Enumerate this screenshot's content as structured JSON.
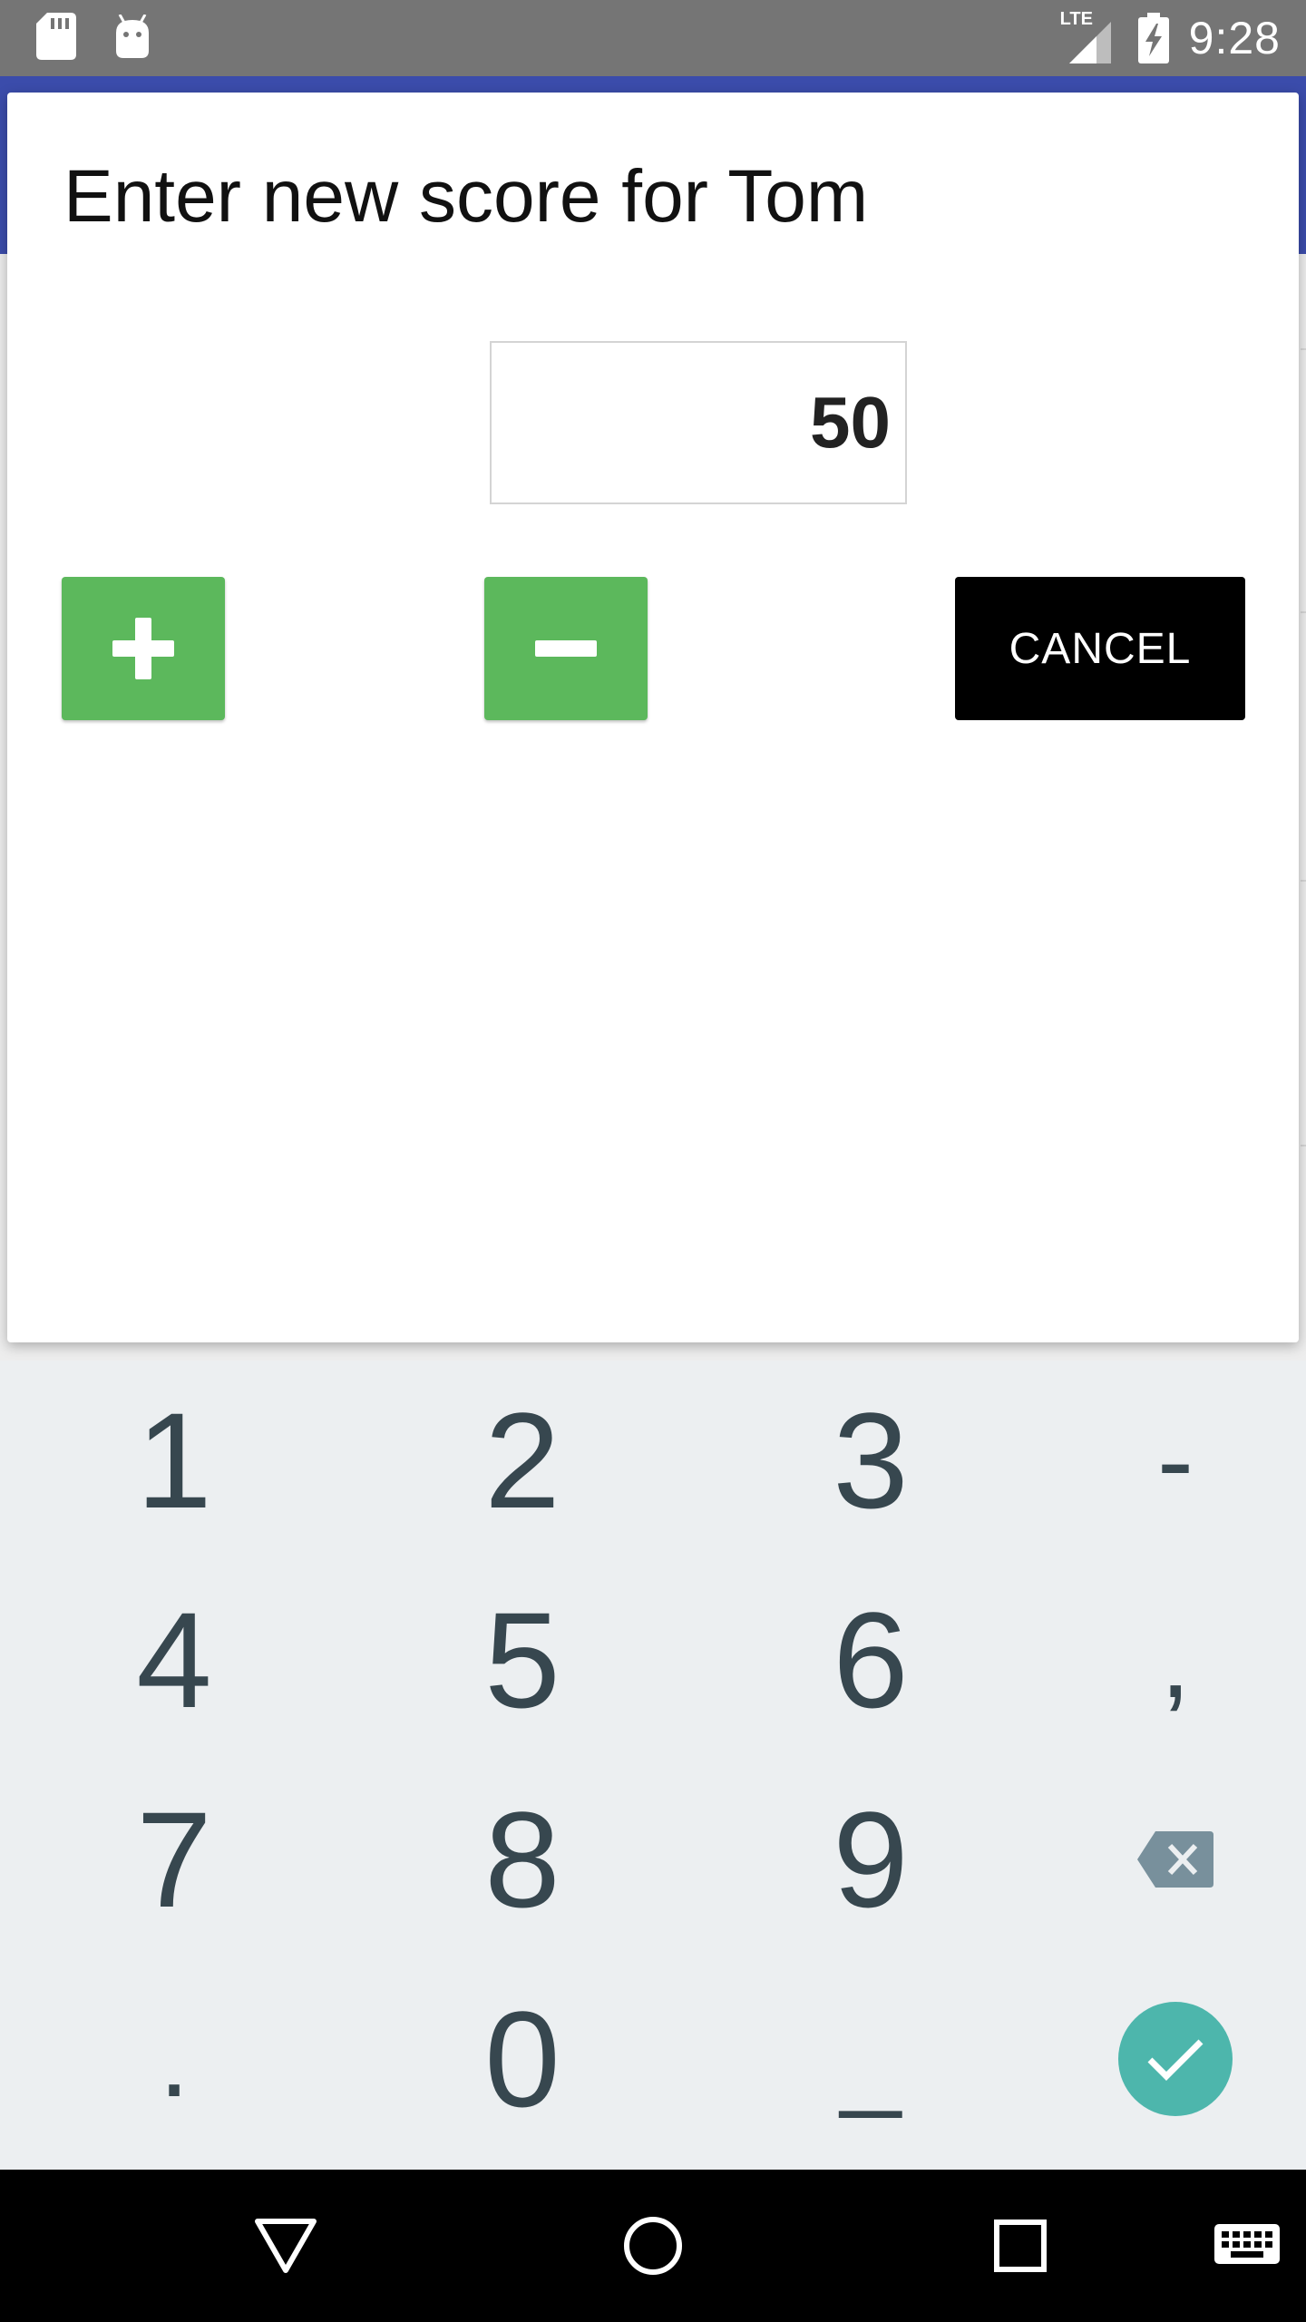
{
  "status_bar": {
    "time": "9:28",
    "network_label": "LTE",
    "icons": [
      "sd-card-icon",
      "android-debug-icon",
      "lte-signal-icon",
      "battery-charging-icon"
    ]
  },
  "dialog": {
    "title": "Enter new score for Tom",
    "score_value": "50",
    "increment_icon": "plus-icon",
    "decrement_icon": "minus-icon",
    "cancel_label": "CANCEL",
    "colors": {
      "action_green": "#5cb85c",
      "cancel_bg": "#000000",
      "toolbar": "#3f51b5"
    }
  },
  "keyboard": {
    "rows": [
      [
        "1",
        "2",
        "3",
        "-"
      ],
      [
        "4",
        "5",
        "6",
        ","
      ],
      [
        "7",
        "8",
        "9",
        "backspace-icon"
      ],
      [
        ".",
        "0",
        "_",
        "enter-check-icon"
      ]
    ],
    "labels": {
      "k1": "1",
      "k2": "2",
      "k3": "3",
      "kdash": "-",
      "k4": "4",
      "k5": "5",
      "k6": "6",
      "kcomma": ",",
      "k7": "7",
      "k8": "8",
      "k9": "9",
      "kdot": ".",
      "k0": "0",
      "kspace": "_"
    },
    "enter_color": "#4db6ac"
  },
  "nav_bar": {
    "buttons": [
      "back-icon",
      "home-icon",
      "recents-icon",
      "keyboard-switch-icon"
    ]
  }
}
